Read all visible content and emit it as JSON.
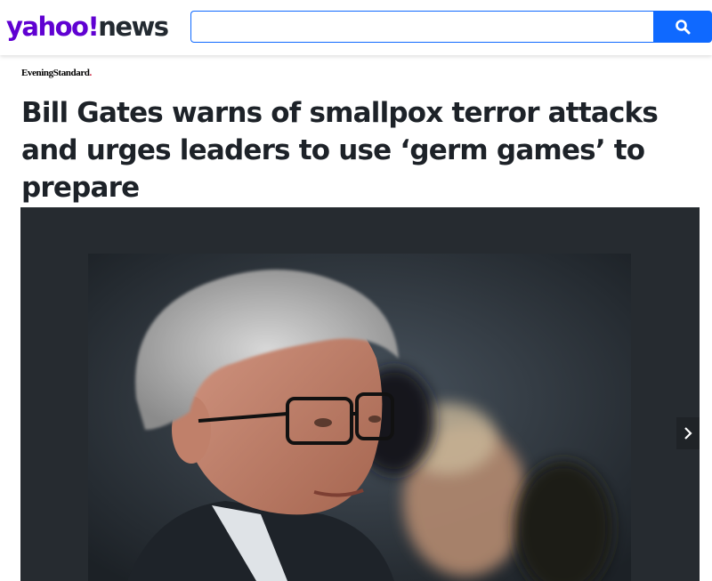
{
  "header": {
    "logo_yahoo": "yahoo!",
    "logo_news": "news",
    "search": {
      "value": "",
      "placeholder": ""
    },
    "search_icon": "search-icon",
    "accent_color": "#0f69ff",
    "brand_color": "#6001d2"
  },
  "article": {
    "source": "EveningStandard",
    "source_dot": ".",
    "headline": "Bill Gates warns of smallpox terror attacks and urges leaders to use ‘germ games’ to prepare"
  },
  "media": {
    "photo_description_icon": "article-photo",
    "next_icon": "chevron-right-icon"
  }
}
